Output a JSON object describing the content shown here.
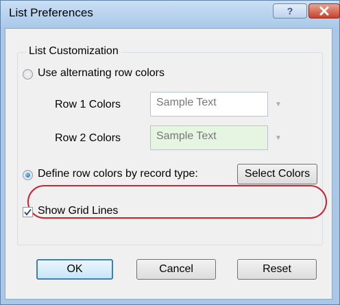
{
  "window": {
    "title": "List Preferences",
    "help_label": "?"
  },
  "group": {
    "title": "List Customization",
    "alternating_label": "Use alternating row colors",
    "row1_label": "Row 1 Colors",
    "row1_sample": "Sample Text",
    "row2_label": "Row 2 Colors",
    "row2_sample": "Sample Text",
    "record_type_label": "Define row colors by record type:",
    "select_colors_label": "Select Colors",
    "grid_lines_label": "Show Grid Lines",
    "alternating_checked": false,
    "record_type_checked": true,
    "grid_lines_checked": true
  },
  "buttons": {
    "ok": "OK",
    "cancel": "Cancel",
    "reset": "Reset"
  },
  "colors": {
    "row1_bg": "#ffffff",
    "row2_bg": "#e6f5e1",
    "highlight": "#c9202a"
  }
}
